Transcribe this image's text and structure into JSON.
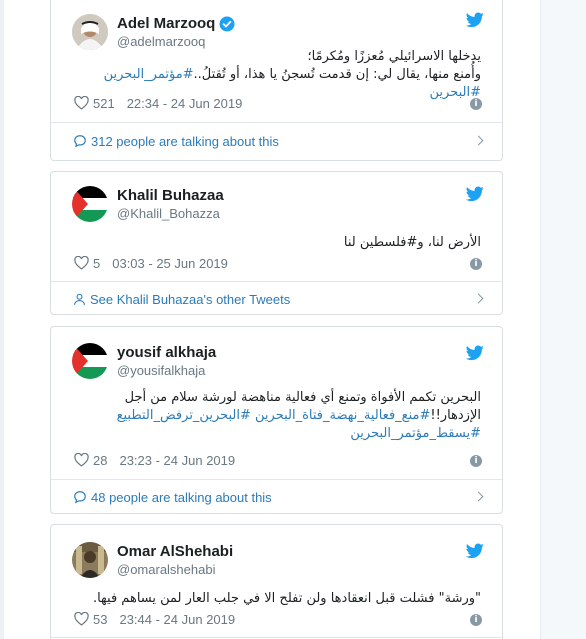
{
  "tweets": [
    {
      "name": "Adel Marzooq",
      "handle": "@adelmarzooq",
      "verified": true,
      "text_line1": "يدخلها الاسرائيلي مُعززًا ومُكرمًا؛",
      "text_line2": "وأُمنع منها، يقال لي: إن قدمت تُسجنُ يا هذا، أو تُقتلُ..",
      "hashtags": "#مؤتمر_البحرين #البحرين",
      "likes": "521",
      "timestamp": "22:34 - 24 Jun 2019",
      "footer": "312 people are talking about this"
    },
    {
      "name": "Khalil Buhazaa",
      "handle": "@Khalil_Bohazza",
      "verified": false,
      "text_line1": "الأرض لنا، و#فلسطين لنا",
      "likes": "5",
      "timestamp": "03:03 - 25 Jun 2019",
      "footer": "See Khalil Buhazaa's other Tweets"
    },
    {
      "name": "yousif alkhaja",
      "handle": "@yousifalkhaja",
      "verified": false,
      "text_line1": "البحرين تكمم الأفواة وتمنع أي فعالية مناهضة لورشة سلام من أجل",
      "text_line2_plain": "الإزدهار!!",
      "text_line2_tags": "#منع_فعالية_نهضة_فتاة_البحرين #البحرين_ترفض_التطبيع",
      "text_line3_tags": "#يسقط_مؤتمر_البحرين",
      "likes": "28",
      "timestamp": "23:23 - 24 Jun 2019",
      "footer": "48 people are talking about this"
    },
    {
      "name": "Omar AlShehabi",
      "handle": "@omaralshehabi",
      "verified": false,
      "text_line1": "\"ورشة\" فشلت قبل انعقادها ولن تفلح الا في جلب العار لمن يساهم فيها.",
      "likes": "53",
      "timestamp": "23:44 - 24 Jun 2019"
    }
  ],
  "colors": {
    "link": "#2b7bb9",
    "muted": "#697882",
    "twitter_blue": "#1da1f2",
    "palestine_red": "#e4312b",
    "palestine_green": "#149954"
  },
  "icons": [
    "twitter-bird-icon",
    "verified-badge-icon",
    "heart-icon",
    "info-icon",
    "speech-bubble-icon",
    "person-icon",
    "chevron-right-icon"
  ]
}
